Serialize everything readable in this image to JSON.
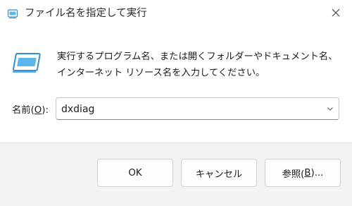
{
  "window": {
    "title": "ファイル名を指定して実行",
    "close_icon": "close-icon"
  },
  "content": {
    "description": "実行するプログラム名、または開くフォルダーやドキュメント名、インターネット リソース名を入力してください。",
    "run_icon": "run-icon"
  },
  "open_field": {
    "label_prefix": "名前(",
    "label_accel": "O",
    "label_suffix": "):",
    "value": "dxdiag",
    "dropdown_icon": "chevron-down-icon"
  },
  "buttons": {
    "ok": "OK",
    "cancel": "キャンセル",
    "browse_prefix": "参照(",
    "browse_accel": "B",
    "browse_suffix": ")..."
  },
  "colors": {
    "accent": "#0067c0",
    "footer_bg": "#f3f3f3",
    "icon_blue": "#38a3e0"
  }
}
